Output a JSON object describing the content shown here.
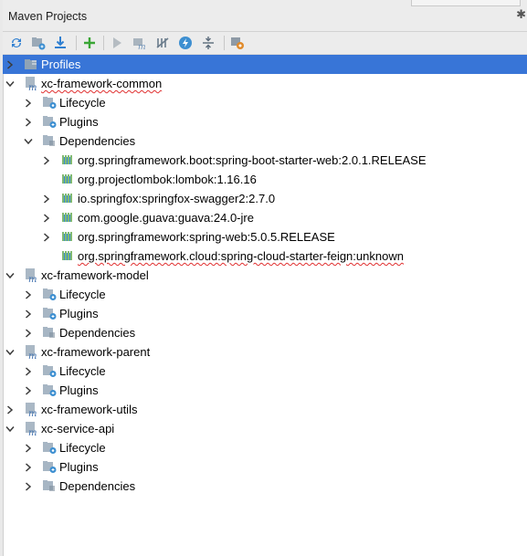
{
  "panel": {
    "title": "Maven Projects"
  },
  "toolbar": {
    "buttons": [
      {
        "name": "reimport-icon"
      },
      {
        "name": "generate-sources-icon"
      },
      {
        "name": "download-icon"
      },
      {
        "name": "add-icon"
      },
      {
        "name": "run-icon"
      },
      {
        "name": "execute-goal-icon"
      },
      {
        "name": "toggle-offline-icon"
      },
      {
        "name": "skip-tests-icon"
      },
      {
        "name": "collapse-all-icon"
      },
      {
        "name": "settings-icon"
      }
    ]
  },
  "tree": {
    "profiles": "Profiles",
    "common": {
      "label": "xc-framework-common",
      "lifecycle": "Lifecycle",
      "plugins": "Plugins",
      "dependencies": "Dependencies",
      "deps": [
        "org.springframework.boot:spring-boot-starter-web:2.0.1.RELEASE",
        "org.projectlombok:lombok:1.16.16",
        "io.springfox:springfox-swagger2:2.7.0",
        "com.google.guava:guava:24.0-jre",
        "org.springframework:spring-web:5.0.5.RELEASE",
        "org.springframework.cloud:spring-cloud-starter-feign:unknown"
      ]
    },
    "model": {
      "label": "xc-framework-model",
      "lifecycle": "Lifecycle",
      "plugins": "Plugins",
      "dependencies": "Dependencies"
    },
    "parent": {
      "label": "xc-framework-parent",
      "lifecycle": "Lifecycle",
      "plugins": "Plugins"
    },
    "utils": {
      "label": "xc-framework-utils"
    },
    "service": {
      "label": "xc-service-api",
      "lifecycle": "Lifecycle",
      "plugins": "Plugins",
      "dependencies": "Dependencies"
    }
  },
  "colors": {
    "selection": "#3875d7",
    "folder": "#a7b6c4",
    "maven_blue": "#3d8fd1",
    "dep_bars": "#62a84f"
  }
}
